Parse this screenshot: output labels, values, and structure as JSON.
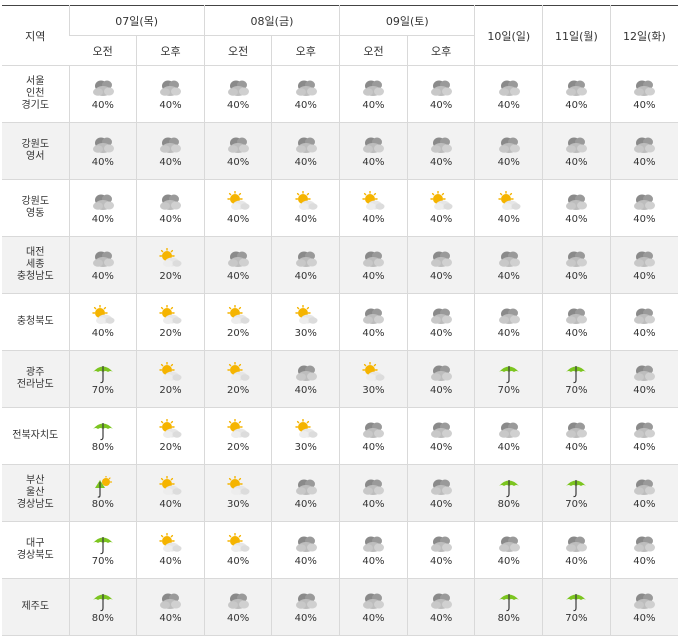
{
  "header": {
    "region_label": "지역",
    "days": [
      {
        "label": "07일(목)",
        "halves": [
          "오전",
          "오후"
        ]
      },
      {
        "label": "08일(금)",
        "halves": [
          "오전",
          "오후"
        ]
      },
      {
        "label": "09일(토)",
        "halves": [
          "오전",
          "오후"
        ]
      }
    ],
    "single_days": [
      "10일(일)",
      "11일(월)",
      "12일(화)"
    ]
  },
  "rows": [
    {
      "region": [
        "서울",
        "인천",
        "경기도"
      ],
      "cells": [
        [
          "cloudy",
          "40%"
        ],
        [
          "cloudy",
          "40%"
        ],
        [
          "cloudy",
          "40%"
        ],
        [
          "cloudy",
          "40%"
        ],
        [
          "cloudy",
          "40%"
        ],
        [
          "cloudy",
          "40%"
        ],
        [
          "cloudy",
          "40%"
        ],
        [
          "cloudy",
          "40%"
        ],
        [
          "cloudy",
          "40%"
        ]
      ]
    },
    {
      "region": [
        "강원도",
        "영서"
      ],
      "cells": [
        [
          "cloudy",
          "40%"
        ],
        [
          "cloudy",
          "40%"
        ],
        [
          "cloudy",
          "40%"
        ],
        [
          "cloudy",
          "40%"
        ],
        [
          "cloudy",
          "40%"
        ],
        [
          "cloudy",
          "40%"
        ],
        [
          "cloudy",
          "40%"
        ],
        [
          "cloudy",
          "40%"
        ],
        [
          "cloudy",
          "40%"
        ]
      ]
    },
    {
      "region": [
        "강원도",
        "영동"
      ],
      "cells": [
        [
          "cloudy",
          "40%"
        ],
        [
          "cloudy",
          "40%"
        ],
        [
          "partly",
          "40%"
        ],
        [
          "partly",
          "40%"
        ],
        [
          "partly",
          "40%"
        ],
        [
          "partly",
          "40%"
        ],
        [
          "partly",
          "40%"
        ],
        [
          "cloudy",
          "40%"
        ],
        [
          "cloudy",
          "40%"
        ]
      ]
    },
    {
      "region": [
        "대전",
        "세종",
        "충청남도"
      ],
      "cells": [
        [
          "cloudy",
          "40%"
        ],
        [
          "partly",
          "20%"
        ],
        [
          "cloudy",
          "40%"
        ],
        [
          "cloudy",
          "40%"
        ],
        [
          "cloudy",
          "40%"
        ],
        [
          "cloudy",
          "40%"
        ],
        [
          "cloudy",
          "40%"
        ],
        [
          "cloudy",
          "40%"
        ],
        [
          "cloudy",
          "40%"
        ]
      ]
    },
    {
      "region": [
        "충청북도"
      ],
      "cells": [
        [
          "partly",
          "40%"
        ],
        [
          "partly",
          "20%"
        ],
        [
          "partly",
          "20%"
        ],
        [
          "partly",
          "30%"
        ],
        [
          "cloudy",
          "40%"
        ],
        [
          "cloudy",
          "40%"
        ],
        [
          "cloudy",
          "40%"
        ],
        [
          "cloudy",
          "40%"
        ],
        [
          "cloudy",
          "40%"
        ]
      ]
    },
    {
      "region": [
        "광주",
        "전라남도"
      ],
      "cells": [
        [
          "rain",
          "70%"
        ],
        [
          "partly",
          "20%"
        ],
        [
          "partly",
          "20%"
        ],
        [
          "cloudy",
          "40%"
        ],
        [
          "partly",
          "30%"
        ],
        [
          "cloudy",
          "40%"
        ],
        [
          "rain",
          "70%"
        ],
        [
          "rain",
          "70%"
        ],
        [
          "cloudy",
          "40%"
        ]
      ]
    },
    {
      "region": [
        "전북자치도"
      ],
      "cells": [
        [
          "rain",
          "80%"
        ],
        [
          "partly",
          "20%"
        ],
        [
          "partly",
          "20%"
        ],
        [
          "partly",
          "30%"
        ],
        [
          "cloudy",
          "40%"
        ],
        [
          "cloudy",
          "40%"
        ],
        [
          "cloudy",
          "40%"
        ],
        [
          "cloudy",
          "40%"
        ],
        [
          "cloudy",
          "40%"
        ]
      ]
    },
    {
      "region": [
        "부산",
        "울산",
        "경상남도"
      ],
      "cells": [
        [
          "sunrain",
          "80%"
        ],
        [
          "partly",
          "40%"
        ],
        [
          "partly",
          "30%"
        ],
        [
          "cloudy",
          "40%"
        ],
        [
          "cloudy",
          "40%"
        ],
        [
          "cloudy",
          "40%"
        ],
        [
          "rain",
          "80%"
        ],
        [
          "rain",
          "70%"
        ],
        [
          "cloudy",
          "40%"
        ]
      ]
    },
    {
      "region": [
        "대구",
        "경상북도"
      ],
      "cells": [
        [
          "rain",
          "70%"
        ],
        [
          "partly",
          "40%"
        ],
        [
          "partly",
          "40%"
        ],
        [
          "cloudy",
          "40%"
        ],
        [
          "cloudy",
          "40%"
        ],
        [
          "cloudy",
          "40%"
        ],
        [
          "cloudy",
          "40%"
        ],
        [
          "cloudy",
          "40%"
        ],
        [
          "cloudy",
          "40%"
        ]
      ]
    },
    {
      "region": [
        "제주도"
      ],
      "cells": [
        [
          "rain",
          "80%"
        ],
        [
          "cloudy",
          "40%"
        ],
        [
          "cloudy",
          "40%"
        ],
        [
          "cloudy",
          "40%"
        ],
        [
          "cloudy",
          "40%"
        ],
        [
          "cloudy",
          "40%"
        ],
        [
          "rain",
          "80%"
        ],
        [
          "rain",
          "70%"
        ],
        [
          "cloudy",
          "40%"
        ]
      ]
    }
  ],
  "icon_names": {
    "cloudy": "dark-cloud-icon",
    "partly": "sun-behind-cloud-icon",
    "rain": "umbrella-rain-icon",
    "sunrain": "sun-umbrella-icon"
  },
  "colors": {
    "cloud_dark": "#8a8a8a",
    "cloud_light": "#d4d4d4",
    "sun": "#f5b400",
    "umbrella": "#7cc520",
    "row_alt": "#f2f2f2"
  }
}
